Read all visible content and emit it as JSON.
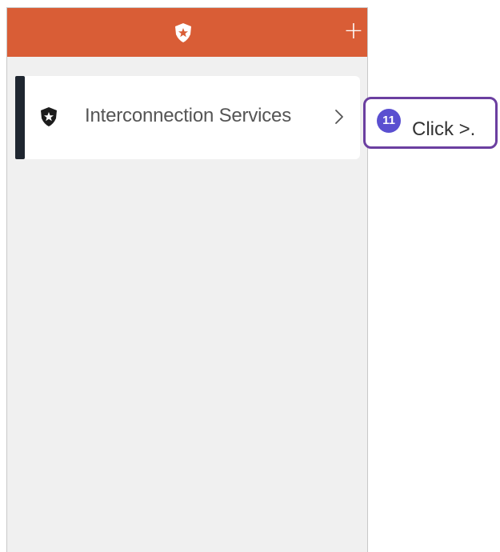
{
  "header": {
    "logo_icon": "shield-star-icon",
    "add_button": "+",
    "color": "#d95d36"
  },
  "services": [
    {
      "label": "Interconnection Services",
      "icon": "shield-star-icon",
      "chevron": "chevron-right-icon",
      "accent_color": "#1f2630"
    }
  ],
  "callout": {
    "step_number": "11",
    "text": "Click >.",
    "border_color": "#6b3fa0",
    "badge_color": "#5a4fd0"
  }
}
